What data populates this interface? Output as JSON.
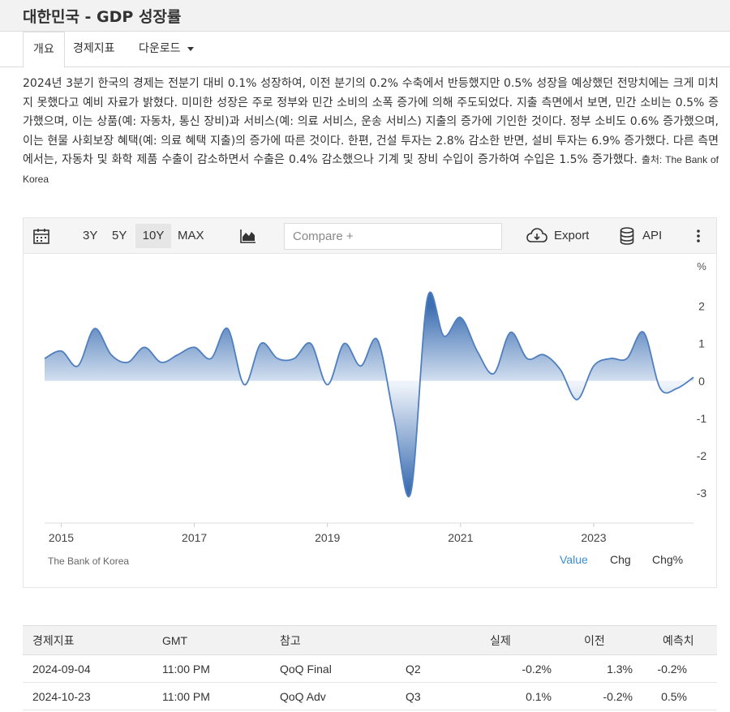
{
  "page": {
    "title": "대한민국 - GDP 성장률"
  },
  "tabs": [
    {
      "label": "개요",
      "active": true
    },
    {
      "label": "경제지표",
      "active": false
    },
    {
      "label": "다운로드",
      "active": false
    }
  ],
  "description": {
    "text": "2024년 3분기 한국의 경제는 전분기 대비 0.1% 성장하여, 이전 분기의 0.2% 수축에서 반등했지만 0.5% 성장을 예상했던 전망치에는 크게 미치지 못했다고 예비 자료가 밝혔다. 미미한 성장은 주로 정부와 민간 소비의 소폭 증가에 의해 주도되었다. 지출 측면에서 보면, 민간 소비는 0.5% 증가했으며, 이는 상품(예: 자동차, 통신 장비)과 서비스(예: 의료 서비스, 운송 서비스) 지출의 증가에 기인한 것이다. 정부 소비도 0.6% 증가했으며, 이는 현물 사회보장 혜택(예: 의료 혜택 지출)의 증가에 따른 것이다. 한편, 건설 투자는 2.8% 감소한 반면, 설비 투자는 6.9% 증가했다. 다른 측면에서는, 자동차 및 화학 제품 수출이 감소하면서 수출은 0.4% 감소했으나 기계 및 장비 수입이 증가하여 수입은 1.5% 증가했다.",
    "source": "출처: The Bank of Korea"
  },
  "toolbar": {
    "calendar_icon": "calendar-icon",
    "ranges": [
      {
        "label": "3Y",
        "active": false
      },
      {
        "label": "5Y",
        "active": false
      },
      {
        "label": "10Y",
        "active": true
      },
      {
        "label": "MAX",
        "active": false
      }
    ],
    "chart_type_icon": "area-chart-icon",
    "compare_placeholder": "Compare +",
    "export_label": "Export",
    "export_icon": "cloud-download-icon",
    "api_label": "API",
    "api_icon": "database-icon",
    "more_icon": "more-vertical-icon"
  },
  "chart_data": {
    "type": "area",
    "unit": "%",
    "x": [
      "2014Q4",
      "2015Q1",
      "2015Q2",
      "2015Q3",
      "2015Q4",
      "2016Q1",
      "2016Q2",
      "2016Q3",
      "2016Q4",
      "2017Q1",
      "2017Q2",
      "2017Q3",
      "2017Q4",
      "2018Q1",
      "2018Q2",
      "2018Q3",
      "2018Q4",
      "2019Q1",
      "2019Q2",
      "2019Q3",
      "2019Q4",
      "2020Q1",
      "2020Q2",
      "2020Q3",
      "2020Q4",
      "2021Q1",
      "2021Q2",
      "2021Q3",
      "2021Q4",
      "2022Q1",
      "2022Q2",
      "2022Q3",
      "2022Q4",
      "2023Q1",
      "2023Q2",
      "2023Q3",
      "2023Q4",
      "2024Q1",
      "2024Q2",
      "2024Q3"
    ],
    "values": [
      0.6,
      0.8,
      0.4,
      1.4,
      0.7,
      0.5,
      0.9,
      0.5,
      0.7,
      0.9,
      0.6,
      1.4,
      -0.1,
      1.0,
      0.6,
      0.6,
      1.0,
      -0.1,
      1.0,
      0.4,
      1.1,
      -1.0,
      -3.0,
      2.2,
      1.2,
      1.7,
      0.8,
      0.2,
      1.3,
      0.6,
      0.7,
      0.3,
      -0.5,
      0.4,
      0.6,
      0.6,
      1.3,
      -0.2,
      -0.2,
      0.1
    ],
    "x_tick_labels": [
      "2015",
      "2017",
      "2019",
      "2021",
      "2023"
    ],
    "y_ticks": [
      2,
      1,
      0,
      -1,
      -2,
      -3
    ],
    "ylim": [
      -3.8,
      3.4
    ],
    "grid": false,
    "color": "#4f7fbf",
    "source": "The Bank of Korea"
  },
  "chart_modes": [
    {
      "label": "Value",
      "active": true
    },
    {
      "label": "Chg",
      "active": false
    },
    {
      "label": "Chg%",
      "active": false
    }
  ],
  "calendar": {
    "headers": [
      "경제지표",
      "GMT",
      "참고",
      "",
      "실제",
      "이전",
      "예측치"
    ],
    "rows": [
      [
        "2024-09-04",
        "11:00 PM",
        "QoQ Final",
        "Q2",
        "-0.2%",
        "1.3%",
        "-0.2%"
      ],
      [
        "2024-10-23",
        "11:00 PM",
        "QoQ Adv",
        "Q3",
        "0.1%",
        "-0.2%",
        "0.5%"
      ]
    ]
  },
  "colors": {
    "accent": "#3a8dd0",
    "area": "#4f7fbf"
  }
}
